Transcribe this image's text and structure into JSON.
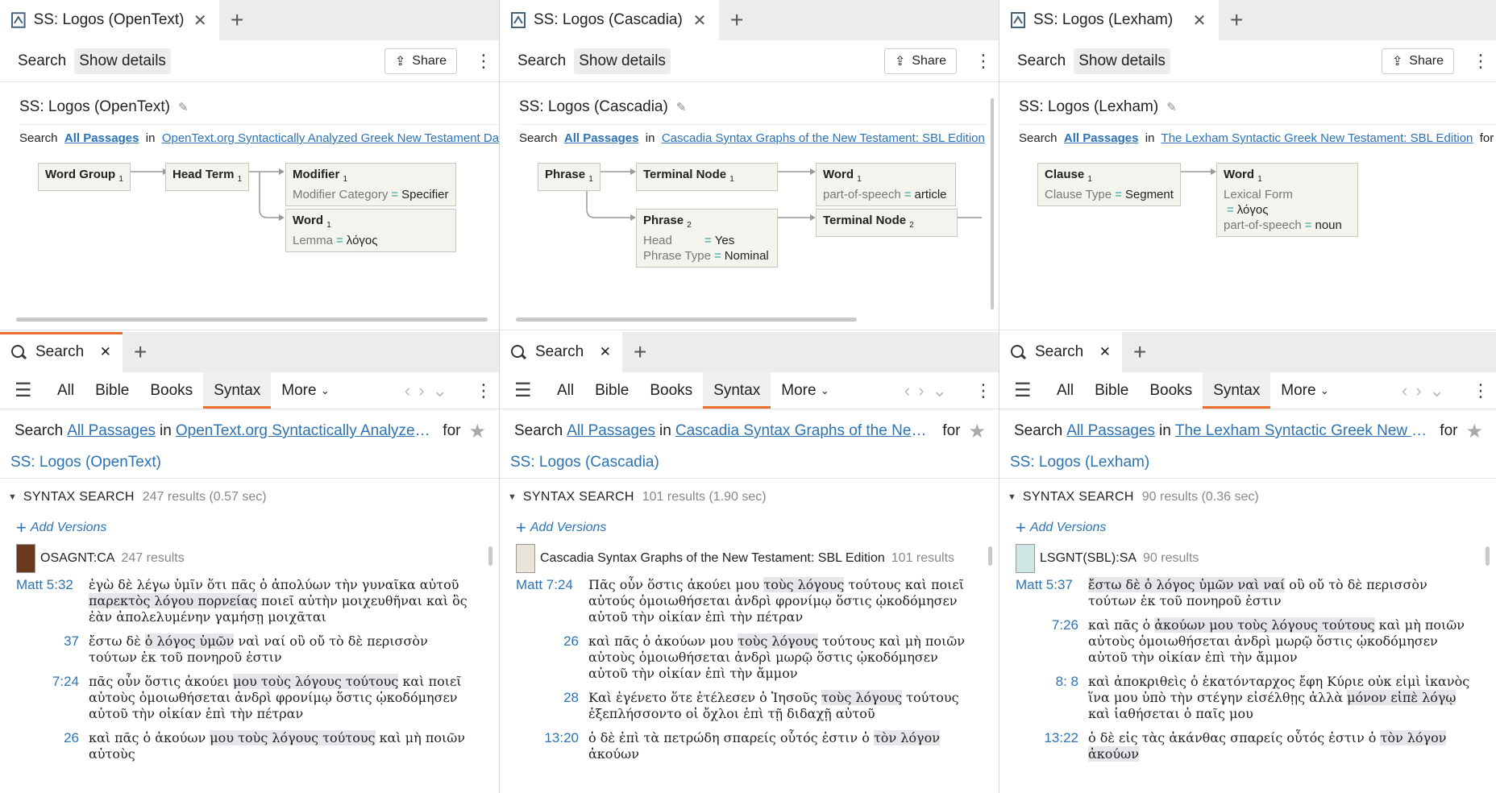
{
  "common": {
    "share_label": "Share",
    "search_label": "Search",
    "show_details_label": "Show details",
    "search_tab_label": "Search",
    "nav": [
      "All",
      "Bible",
      "Books",
      "Syntax",
      "More"
    ],
    "search_word": "Search",
    "all_passages": "All Passages",
    "in_word": "in",
    "for_word": "for",
    "results_title": "SYNTAX SEARCH",
    "add_versions": "Add Versions"
  },
  "panes": [
    {
      "tab_title": "SS: Logos (OpenText)",
      "query_title": "SS: Logos (OpenText)",
      "query_book": "OpenText.org Syntactically Analyzed Greek New Testament Database",
      "nodes": [
        {
          "title": "Word Group",
          "sub": "1"
        },
        {
          "title": "Head Term",
          "sub": "1"
        },
        {
          "title": "Modifier",
          "sub": "1",
          "k1": "Modifier Category",
          "v1": "Specifier"
        },
        {
          "title": "Word",
          "sub": "1",
          "k1": "Lemma",
          "v1": "λόγος"
        }
      ],
      "search_book_short": "OpenText.org Syntactically Analyzed Gr…",
      "saved_name": "SS: Logos (OpenText)",
      "result_count": "247 results (0.57 sec)",
      "book_abbrev": "OSAGNT:CA",
      "book_count": "247 results",
      "verses": [
        {
          "ref": "Matt 5:32",
          "pre": "ἐγὼ δὲ λέγω ὑμῖν ὅτι πᾶς ὁ ἀπολύων τὴν γυναῖκα αὐτοῦ ",
          "hl": "παρεκτὸς λόγου πορνείας",
          "post": " ποιεῖ αὐτὴν μοιχευθῆναι καὶ ὃς ἐὰν ἀπολελυμένην γαμήσῃ μοιχᾶται"
        },
        {
          "ref": "37",
          "pre": "ἔστω δὲ ",
          "hl": "ὁ λόγος ὑμῶν",
          "post": " ναὶ ναί οὒ οὔ τὸ δὲ περισσὸν τούτων ἐκ τοῦ πονηροῦ ἐστιν"
        },
        {
          "ref": "7:24",
          "pre": "πᾶς οὖν ὅστις ἀκούει ",
          "hl": "μου τοὺς λόγους τούτους",
          "post": " καὶ ποιεῖ αὐτοὺς ὁμοιωθήσεται ἀνδρὶ φρονίμῳ ὅστις ᾠκοδόμησεν αὐτοῦ τὴν οἰκίαν ἐπὶ τὴν πέτραν"
        },
        {
          "ref": "26",
          "pre": "καὶ πᾶς ὁ ἀκούων ",
          "hl": "μου τοὺς λόγους τούτους",
          "post": " καὶ μὴ ποιῶν αὐτοὺς"
        }
      ]
    },
    {
      "tab_title": "SS: Logos (Cascadia)",
      "query_title": "SS: Logos (Cascadia)",
      "query_book": "Cascadia Syntax Graphs of the New Testament: SBL Edition",
      "nodes": [
        {
          "title": "Phrase",
          "sub": "1"
        },
        {
          "title": "Terminal Node",
          "sub": "1"
        },
        {
          "title": "Word",
          "sub": "1",
          "k1": "part-of-speech",
          "v1": "article"
        },
        {
          "title": "Phrase",
          "sub": "2",
          "k1": "Head",
          "v1": "Yes",
          "k2": "Phrase Type",
          "v2": "Nominal"
        },
        {
          "title": "Terminal Node",
          "sub": "2"
        }
      ],
      "search_book_short": "Cascadia Syntax Graphs of the New Tes…",
      "saved_name": "SS: Logos (Cascadia)",
      "result_count": "101 results (1.90 sec)",
      "book_abbrev": "Cascadia Syntax Graphs of the New Testament: SBL Edition",
      "book_count": "101 results",
      "verses": [
        {
          "ref": "Matt 7:24",
          "pre": "Πᾶς οὖν ὅστις ἀκούει μου ",
          "hl": "τοὺς λόγους",
          "post": " τούτους καὶ ποιεῖ αὐτούς ὁμοιωθήσεται ἀνδρὶ φρονίμῳ ὅστις ᾠκοδόμησεν αὐτοῦ τὴν οἰκίαν ἐπὶ τὴν πέτραν"
        },
        {
          "ref": "26",
          "pre": "καὶ πᾶς ὁ ἀκούων μου ",
          "hl": "τοὺς λόγους",
          "post": " τούτους καὶ μὴ ποιῶν αὐτοὺς ὁμοιωθήσεται ἀνδρὶ μωρῷ ὅστις ᾠκοδόμησεν αὐτοῦ τὴν οἰκίαν ἐπὶ τὴν ἄμμον"
        },
        {
          "ref": "28",
          "pre": "Καὶ ἐγένετο ὅτε ἐτέλεσεν ὁ Ἰησοῦς ",
          "hl": "τοὺς λόγους",
          "post": " τούτους ἐξεπλήσσοντο οἱ ὄχλοι ἐπὶ τῇ διδαχῇ αὐτοῦ"
        },
        {
          "ref": "13:20",
          "pre": "ὁ δὲ ἐπὶ τὰ πετρώδη σπαρείς οὗτός ἐστιν ὁ ",
          "hl": "τὸν λόγον",
          "post": " ἀκούων"
        }
      ]
    },
    {
      "tab_title": "SS: Logos (Lexham)",
      "query_title": "SS: Logos (Lexham)",
      "query_book": "The Lexham Syntactic Greek New Testament: SBL Edition",
      "nodes": [
        {
          "title": "Clause",
          "sub": "1",
          "k1": "Clause Type",
          "v1": "Segment"
        },
        {
          "title": "Word",
          "sub": "1",
          "k1": "Lexical Form",
          "v1": "λόγος",
          "k2": "part-of-speech",
          "v2": "noun"
        }
      ],
      "search_book_short": "The Lexham Syntactic Greek New Testa…",
      "saved_name": "SS: Logos (Lexham)",
      "result_count": "90 results (0.36 sec)",
      "book_abbrev": "LSGNT(SBL):SA",
      "book_count": "90 results",
      "verses": [
        {
          "ref": "Matt 5:37",
          "pre": "",
          "hl": "ἔστω δὲ ὁ λόγος ὑμῶν ναὶ ναί",
          "post": " οὒ οὔ τὸ δὲ περισσὸν τούτων ἐκ τοῦ πονηροῦ ἐστιν"
        },
        {
          "ref": "7:26",
          "pre": "καὶ πᾶς ὁ ",
          "hl": "ἀκούων μου τοὺς λόγους τούτους",
          "post": " καὶ μὴ ποιῶν αὐτοὺς ὁμοιωθήσεται ἀνδρὶ μωρῷ ὅστις ᾠκοδόμησεν αὐτοῦ τὴν οἰκίαν ἐπὶ τὴν ἄμμον"
        },
        {
          "ref": "8: 8",
          "pre": "καὶ ἀποκριθεὶς ὁ ἑκατόνταρχος ἔφη Κύριε οὐκ εἰμὶ ἱκανὸς ἵνα μου ὑπὸ τὴν στέγην εἰσέλθῃς ἀλλὰ ",
          "hl": "μόνον εἰπὲ λόγῳ",
          "post": " καὶ ἰαθήσεται ὁ παῖς μου"
        },
        {
          "ref": "13:22",
          "pre": "ὁ δὲ εἰς τὰς ἀκάνθας σπαρείς οὗτός ἐστιν ὁ ",
          "hl": "τὸν λόγον ἀκούων",
          "post": ""
        }
      ]
    }
  ]
}
